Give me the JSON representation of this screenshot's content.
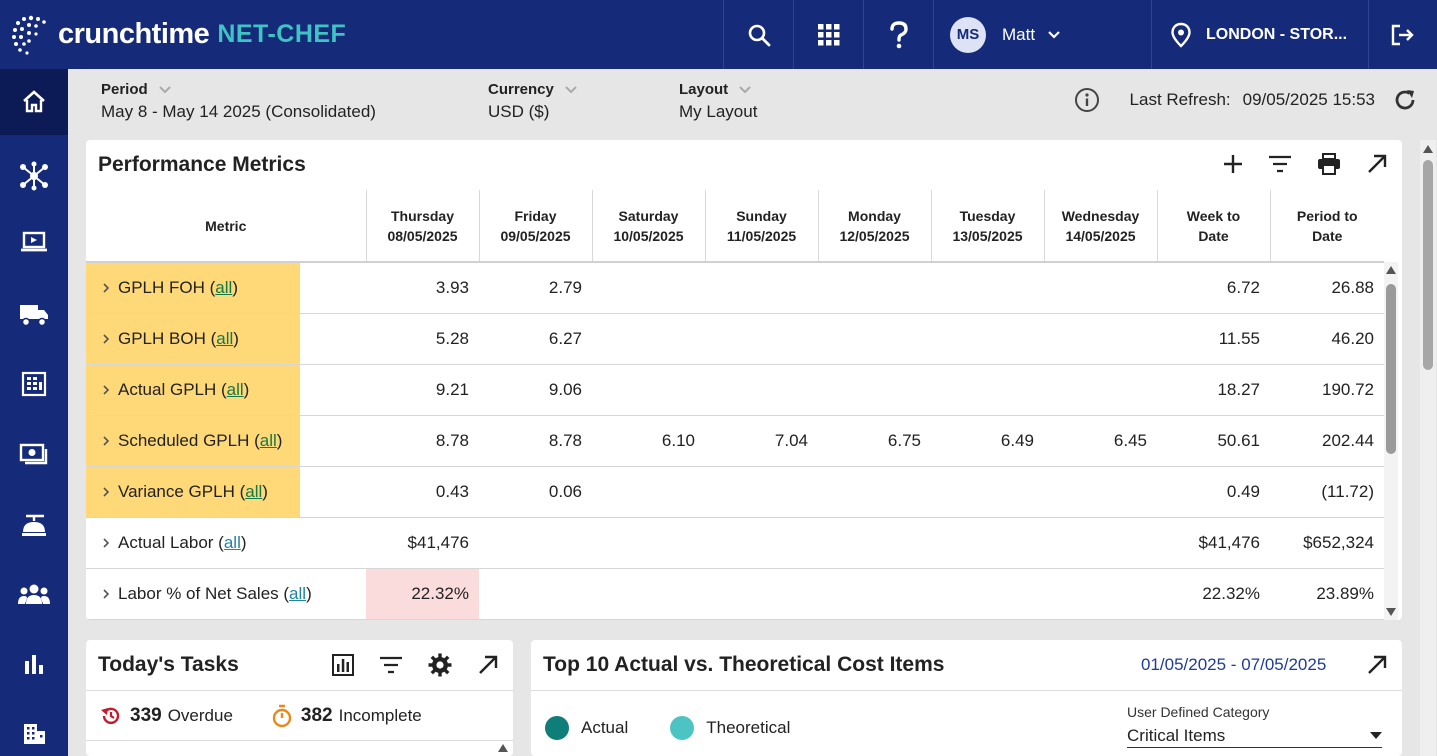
{
  "topbar": {
    "brand_name": "crunchtime",
    "brand_product": "NET-CHEF",
    "user_initials": "MS",
    "user_name": "Matt",
    "location": "LONDON - STOR..."
  },
  "filters": {
    "period_label": "Period",
    "period_value": "May 8 - May 14 2025 (Consolidated)",
    "currency_label": "Currency",
    "currency_value": "USD ($)",
    "layout_label": "Layout",
    "layout_value": "My Layout",
    "refresh_label": "Last Refresh:",
    "refresh_value": "09/05/2025 15:53"
  },
  "performance": {
    "title": "Performance Metrics",
    "columns": [
      {
        "line1": "Metric",
        "line2": ""
      },
      {
        "line1": "Thursday",
        "line2": "08/05/2025"
      },
      {
        "line1": "Friday",
        "line2": "09/05/2025"
      },
      {
        "line1": "Saturday",
        "line2": "10/05/2025"
      },
      {
        "line1": "Sunday",
        "line2": "11/05/2025"
      },
      {
        "line1": "Monday",
        "line2": "12/05/2025"
      },
      {
        "line1": "Tuesday",
        "line2": "13/05/2025"
      },
      {
        "line1": "Wednesday",
        "line2": "14/05/2025"
      },
      {
        "line1": "Week to",
        "line2": "Date"
      },
      {
        "line1": "Period to",
        "line2": "Date"
      }
    ],
    "all_link": "all",
    "rows": [
      {
        "name": "GPLH FOH",
        "highlight": true,
        "cells": [
          "3.93",
          "2.79",
          "",
          "",
          "",
          "",
          "",
          "6.72",
          "26.88"
        ]
      },
      {
        "name": "GPLH BOH",
        "highlight": true,
        "cells": [
          "5.28",
          "6.27",
          "",
          "",
          "",
          "",
          "",
          "11.55",
          "46.20"
        ]
      },
      {
        "name": "Actual GPLH",
        "highlight": true,
        "cells": [
          "9.21",
          "9.06",
          "",
          "",
          "",
          "",
          "",
          "18.27",
          "190.72"
        ]
      },
      {
        "name": "Scheduled GPLH",
        "highlight": true,
        "cells": [
          "8.78",
          "8.78",
          "6.10",
          "7.04",
          "6.75",
          "6.49",
          "6.45",
          "50.61",
          "202.44"
        ]
      },
      {
        "name": "Variance GPLH",
        "highlight": true,
        "cells": [
          "0.43",
          "0.06",
          "",
          "",
          "",
          "",
          "",
          "0.49",
          "(11.72)"
        ]
      },
      {
        "name": "Actual Labor",
        "highlight": false,
        "cells": [
          "$41,476",
          "",
          "",
          "",
          "",
          "",
          "",
          "$41,476",
          "$652,324"
        ]
      },
      {
        "name": "Labor % of Net Sales",
        "highlight": false,
        "cells": [
          "22.32%",
          "",
          "",
          "",
          "",
          "",
          "",
          "22.32%",
          "23.89%"
        ]
      }
    ]
  },
  "tasks": {
    "title": "Today's Tasks",
    "overdue_count": "339",
    "overdue_label": "Overdue",
    "incomplete_count": "382",
    "incomplete_label": "Incomplete"
  },
  "cost": {
    "title": "Top 10 Actual vs. Theoretical Cost Items",
    "date_range": "01/05/2025 - 07/05/2025",
    "legend_actual": "Actual",
    "legend_theoretical": "Theoretical",
    "actual_color": "#0f7d78",
    "theoretical_color": "#4cc4c4",
    "category_label": "User Defined Category",
    "category_value": "Critical Items"
  },
  "colors": {
    "nav": "#152b79",
    "brand_accent": "#3ec4c4",
    "highlight": "#ffd978",
    "negative": "#c5192d"
  }
}
